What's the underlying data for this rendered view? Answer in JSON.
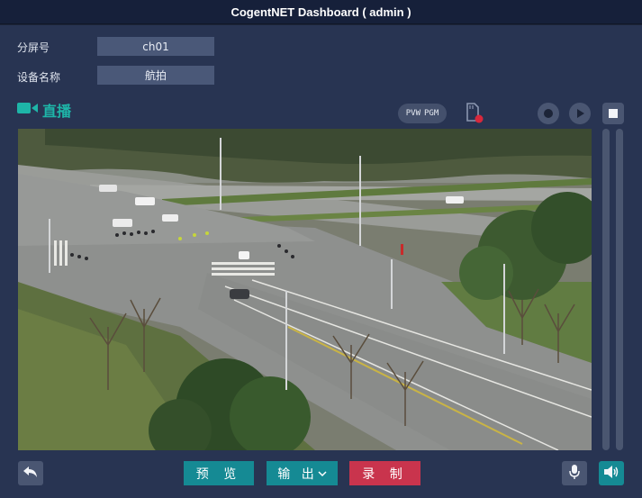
{
  "window": {
    "title": "CogentNET Dashboard ( admin )"
  },
  "info": {
    "screen_label": "分屏号",
    "screen_value": "ch01",
    "device_label": "设备名称",
    "device_value": "航拍"
  },
  "live": {
    "label": "直播"
  },
  "preview_toggle": {
    "pvw": "PVW",
    "pgm": "PGM"
  },
  "controls": {
    "preview_label": "预 览",
    "output_label": "输 出",
    "record_label": "录 制"
  },
  "colors": {
    "accent": "#1eb5a8",
    "preview_btn": "#158a94",
    "output_btn": "#158a94",
    "record_btn": "#c9344d",
    "sound_btn": "#158a94"
  }
}
